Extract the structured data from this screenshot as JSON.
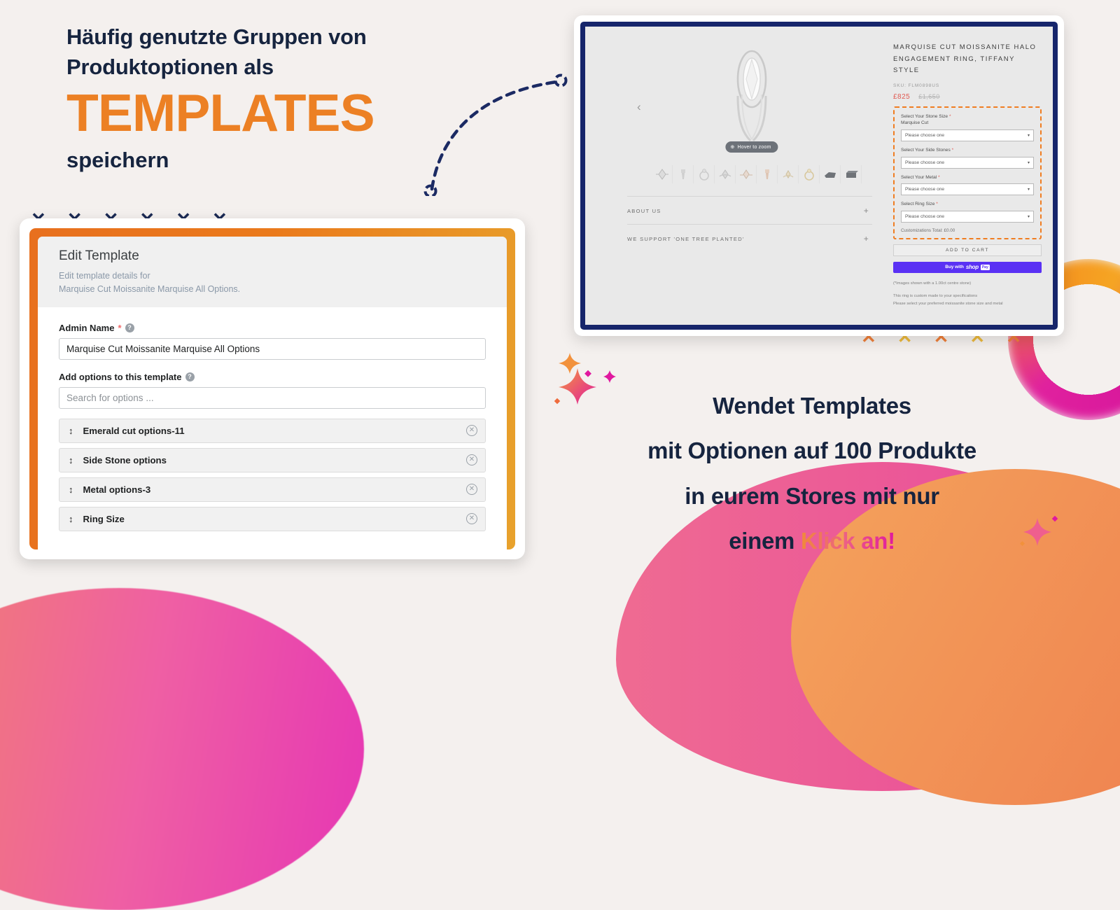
{
  "headline": {
    "line1": "Häufig genutzte Gruppen von",
    "line2": "Produktoptionen als",
    "big": "TEMPLATES",
    "line3": "speichern"
  },
  "marketing": {
    "line1": "Wendet Templates",
    "line2": "mit Optionen auf 100 Produkte",
    "line3": "in eurem Stores mit nur",
    "line4_plain": "einem ",
    "line4_accent": "Klick an!"
  },
  "admin_card": {
    "title": "Edit Template",
    "subtitle_line1": "Edit template details for",
    "subtitle_line2": "Marquise Cut Moissanite Marquise All Options.",
    "admin_name_label": "Admin Name",
    "required_mark": "*",
    "help_glyph": "?",
    "admin_name_value": "Marquise Cut Moissanite Marquise All Options",
    "add_options_label": "Add options to this template",
    "search_placeholder": "Search for options ...",
    "drag_glyph": "↕",
    "remove_glyph": "✕",
    "options": [
      {
        "name": "Emerald cut options-11"
      },
      {
        "name": "Side Stone options"
      },
      {
        "name": "Metal options-3"
      },
      {
        "name": "Ring Size"
      }
    ]
  },
  "storefront": {
    "prev_arrow": "‹",
    "zoom_badge": "Hover to zoom",
    "zoom_badge_icon": "⊕",
    "accordions": [
      {
        "label": "ABOUT US",
        "toggle": "+"
      },
      {
        "label": "WE SUPPORT 'ONE TREE PLANTED'",
        "toggle": "+"
      }
    ],
    "product_title": "MARQUISE CUT MOISSANITE HALO ENGAGEMENT RING, TIFFANY STYLE",
    "sku": "SKU: FLM0898US",
    "price_current": "£825",
    "price_compare": "£1,650",
    "options": [
      {
        "label": "Select Your Stone Size",
        "required": "*",
        "sublabel": "Marquise Cut",
        "value": "Please choose one"
      },
      {
        "label": "Select Your Side Stones",
        "required": "*",
        "sublabel": "",
        "value": "Please choose one"
      },
      {
        "label": "Select Your Metal",
        "required": "*",
        "sublabel": "",
        "value": "Please choose one"
      },
      {
        "label": "Select Ring Size",
        "required": "*",
        "sublabel": "",
        "value": "Please choose one"
      }
    ],
    "caret_glyph": "▾",
    "customizations_total": "Customizations Total: £0.00",
    "add_to_cart": "ADD TO CART",
    "shop_pay": {
      "prefix": "Buy with",
      "brand": "shop",
      "badge": "Pay"
    },
    "note_images": "(*Images shown with a 1.00ct centre stone)",
    "note_custom_line1": "This ring is custom made to your specifications",
    "note_custom_line2": "Please select your preferred moissanite stone size and metal"
  },
  "decorations": {
    "x_mark": "✕",
    "x_row_top_count": 6,
    "x_row_bottom_count": 5
  },
  "colors": {
    "navy": "#16243f",
    "orange": "#ec8024",
    "magenta": "#e0189f",
    "page_bg": "#f4f0ee",
    "shop_pay_purple": "#5a31f4",
    "price_red": "#e0584f",
    "tablet_border": "#16256b"
  }
}
